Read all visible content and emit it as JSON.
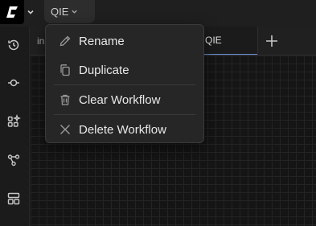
{
  "app": {
    "workflow_name": "QIE"
  },
  "tabs": [
    {
      "label": "in"
    },
    {
      "label": "QIE"
    }
  ],
  "menu": {
    "items": [
      {
        "label": "Rename",
        "icon": "pencil-icon"
      },
      {
        "label": "Duplicate",
        "icon": "copy-icon"
      },
      {
        "label": "Clear Workflow",
        "icon": "trash-icon"
      },
      {
        "label": "Delete Workflow",
        "icon": "close-icon"
      }
    ]
  },
  "sidebar": {
    "items": [
      {
        "icon": "history-icon"
      },
      {
        "icon": "model-icon"
      },
      {
        "icon": "nodes-sparkle-icon"
      },
      {
        "icon": "workflow-branch-icon"
      },
      {
        "icon": "templates-icon"
      }
    ]
  },
  "colors": {
    "background": "#181818",
    "menu_bg": "#262626",
    "active_tab_underline": "#6b8fd6",
    "text": "#e8e8e8"
  }
}
